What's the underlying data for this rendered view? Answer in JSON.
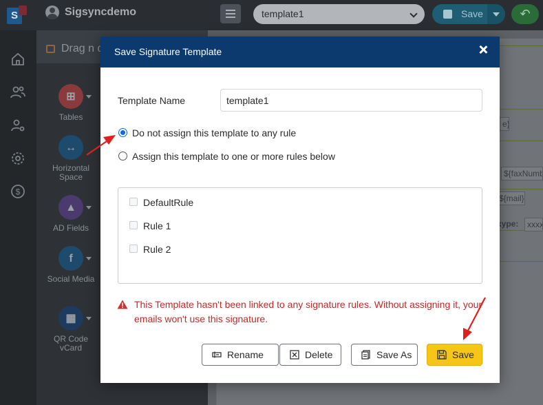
{
  "app": {
    "name": "Sigsyncdemo",
    "logo_letter": "S"
  },
  "toolbar": {
    "template_select_value": "template1",
    "save_label": "Save"
  },
  "left_panel": {
    "header": "Drag n d",
    "tools": [
      {
        "label": "Tables",
        "icon": "table-icon"
      },
      {
        "label": "Horizontal Space",
        "icon": "horizontal-space-icon"
      },
      {
        "label": "AD Fields",
        "icon": "azure-icon"
      },
      {
        "label": "Social Media",
        "icon": "facebook-icon"
      },
      {
        "label": "QR Code vCard",
        "icon": "qr-code-icon"
      }
    ]
  },
  "canvas_chips": {
    "c1": "e}",
    "c2": "${faxNumb",
    "c3": "${mail}",
    "c4": "xype:",
    "c5": "xxxx"
  },
  "modal": {
    "title": "Save Signature Template",
    "template_name_label": "Template Name",
    "template_name_value": "template1",
    "radio_options": [
      {
        "label": "Do not assign this template to any rule",
        "checked": true
      },
      {
        "label": "Assign this template to one or more rules below",
        "checked": false
      }
    ],
    "rules": [
      "DefaultRule",
      "Rule 1",
      "Rule 2"
    ],
    "warning": "This Template hasn't been linked to any signature rules. Without assigning it, your emails won't use this signature.",
    "buttons": {
      "rename": "Rename",
      "delete": "Delete",
      "save_as": "Save As",
      "save": "Save"
    }
  },
  "colors": {
    "header_bg": "#0d3a6e",
    "save_button": "#f5c518",
    "warning": "#c62828",
    "annotation_arrow": "#e02020",
    "radio_accent": "#0b6ed6"
  }
}
